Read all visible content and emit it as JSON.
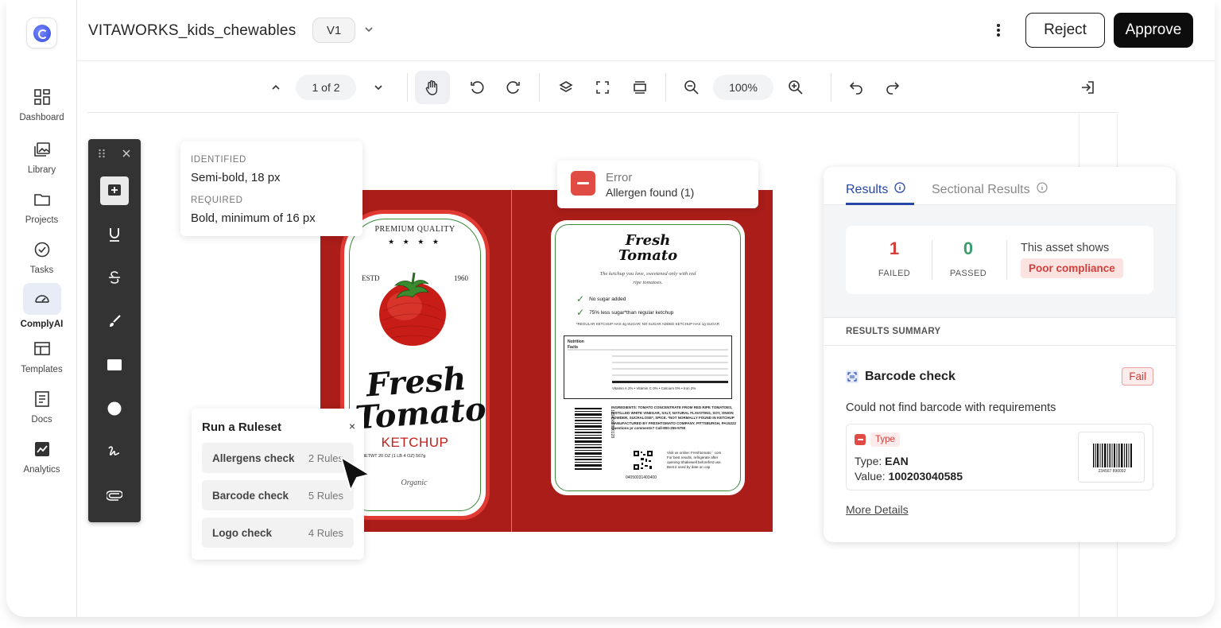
{
  "app": {
    "title": "VITAWORKS_kids_chewables",
    "version": "V1",
    "reject_label": "Reject",
    "approve_label": "Approve"
  },
  "sidebar": {
    "items": [
      {
        "label": "Dashboard",
        "icon": "dashboard-icon"
      },
      {
        "label": "Library",
        "icon": "library-icon"
      },
      {
        "label": "Projects",
        "icon": "folder-icon"
      },
      {
        "label": "Tasks",
        "icon": "check-circle-icon"
      },
      {
        "label": "ComplyAI",
        "icon": "gauge-icon",
        "active": true
      },
      {
        "label": "Templates",
        "icon": "templates-icon"
      },
      {
        "label": "Docs",
        "icon": "docs-icon"
      },
      {
        "label": "Analytics",
        "icon": "analytics-icon"
      }
    ]
  },
  "toolbar": {
    "page_indicator": "1 of 2",
    "zoom": "100%"
  },
  "font_card": {
    "identified_label": "IDENTIFIED",
    "identified_value": "Semi-bold, 18 px",
    "required_label": "REQUIRED",
    "required_value": "Bold, minimum of 16 px"
  },
  "error_card": {
    "title": "Error",
    "message": "Allergen found (1)"
  },
  "ruleset": {
    "title": "Run a Ruleset",
    "close": "×",
    "items": [
      {
        "name": "Allergens check",
        "count": "2 Rules"
      },
      {
        "name": "Barcode check",
        "count": "5 Rules"
      },
      {
        "name": "Logo check",
        "count": "4 Rules"
      }
    ]
  },
  "artwork": {
    "front": {
      "premium": "PREMIUM QUALITY",
      "stars": "★ ★ ★ ★",
      "estd": "ESTD",
      "year": "1960",
      "brand": "Fresh Tomato",
      "product": "KETCHUP",
      "net_wt": "NETWT 20 OZ (1 LB 4 OZ) 567g",
      "organic": "Organic"
    },
    "back": {
      "brand": "Fresh Tomato",
      "tagline": "The ketchup you love, sweetened only with red ripe tomatoes.",
      "check1": "No sugar added",
      "check2": "75% less sugar*than regular ketchup",
      "note": "*REGULAR KETCHUP HAS 4g SUGAR; NO SUGAR ADDED KETCHUP HAS 1g SUGAR",
      "nutrition_title": "Nutrition Facts",
      "vitamins": "Vitamin A 2% • Vitamin C 0% • Calcium 0% • Iron 2%",
      "ingredients": "INGREDIENTS: TOMATO CONCENTRATE FROM RED RIPE TOMATOES, DISTILLED WHITE VINEGAR, SALT, NATURAL FLAVOTING, SOY, ONION POWDER, SUCRALOSE*, SPICE. *NOT NORMALLY FOUND IN KETCHUP",
      "manufacturer": "MANUFACTURED BY FRESHTOMATO COMPANY. PITTSBURGH, PA15222",
      "questions": "Questions pr comments? Call-800-255-5750",
      "barcode_digits": "1234567890128",
      "qr_number": "04050031403400",
      "visit": "Visit us online: Freshtomato`` com For best results, refrigerate after opening Shakewell beforefirst use. Best it used by date on cap"
    }
  },
  "results": {
    "tab_results": "Results",
    "tab_sectional": "Sectional Results",
    "failed_count": "1",
    "failed_label": "FAILED",
    "passed_count": "0",
    "passed_label": "PASSED",
    "asset_text": "This asset shows",
    "compliance_badge": "Poor compliance",
    "summary_heading": "RESULTS SUMMARY",
    "check_title": "Barcode check",
    "check_status": "Fail",
    "check_desc": "Could not find barcode with requirements",
    "type_chip": "Type",
    "type_label": "Type: ",
    "type_value": "EAN",
    "value_label": "Value: ",
    "value_value": "100203040585",
    "barcode_caption": "234567 890092",
    "more_details": "More Details"
  },
  "colors": {
    "accent": "#2447a8",
    "error": "#e04b44",
    "passed": "#3a9d6e",
    "artwork_red": "#aa1d19"
  }
}
